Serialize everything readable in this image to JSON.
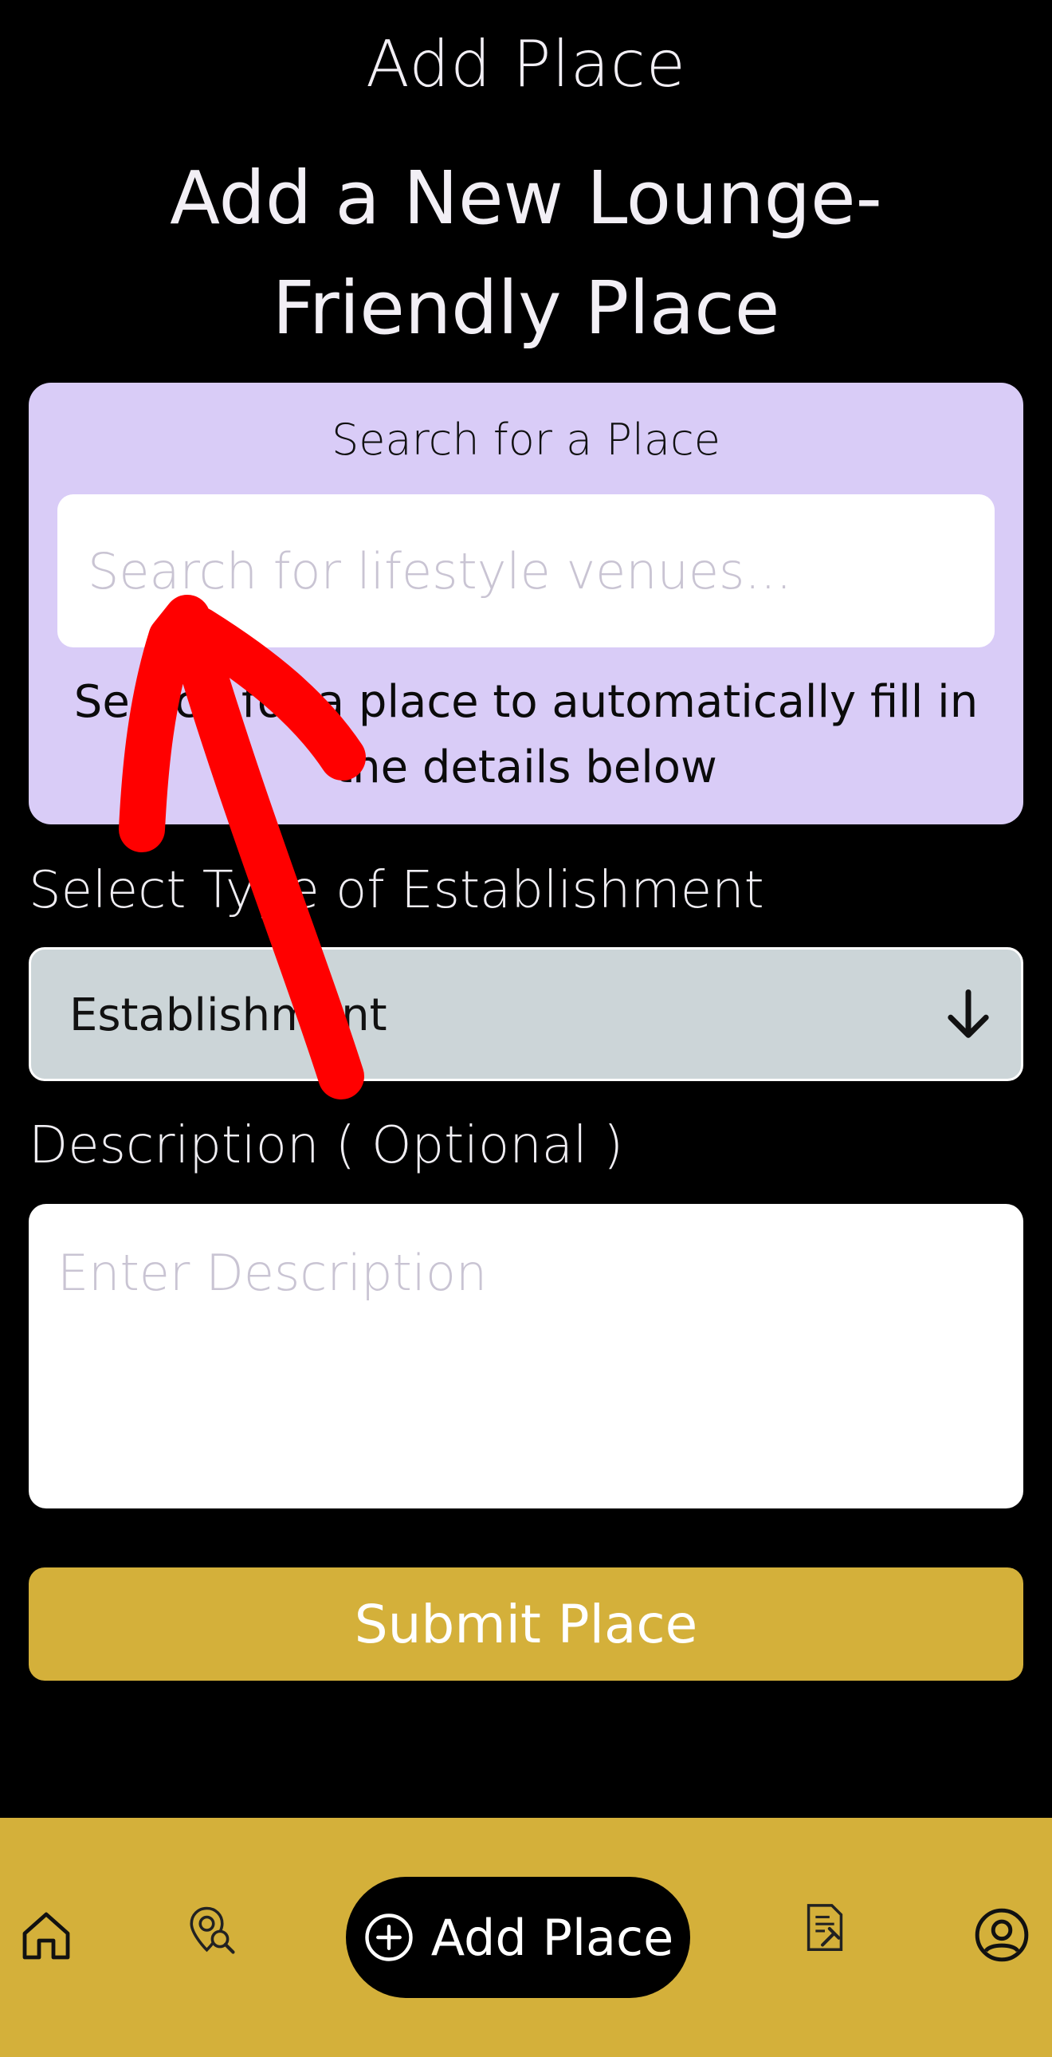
{
  "header": {
    "title": "Add Place"
  },
  "heading": {
    "line1": "Add a New Lounge-",
    "line2": "Friendly Place"
  },
  "search_card": {
    "title": "Search for a Place",
    "input_placeholder": "Search for lifestyle venues...",
    "help_line1": "Search for a place to automatically fill in",
    "help_line2": "the details below"
  },
  "establishment": {
    "label": "Select Type of Establishment",
    "selected": "Establishment",
    "icon": "arrow-down-icon"
  },
  "description": {
    "label": "Description ( Optional )",
    "placeholder": "Enter Description"
  },
  "submit": {
    "label": "Submit Place"
  },
  "bottom_nav": {
    "items": [
      {
        "icon": "home-icon"
      },
      {
        "icon": "map-search-icon"
      },
      {
        "icon": "add-circle-icon",
        "label": "Add Place"
      },
      {
        "icon": "document-gavel-icon"
      },
      {
        "icon": "profile-icon"
      }
    ]
  },
  "colors": {
    "background": "#000000",
    "card": "#d9ccf7",
    "accent": "#d4b03a",
    "select": "#ccd5d8",
    "annotation": "#ff0000"
  }
}
